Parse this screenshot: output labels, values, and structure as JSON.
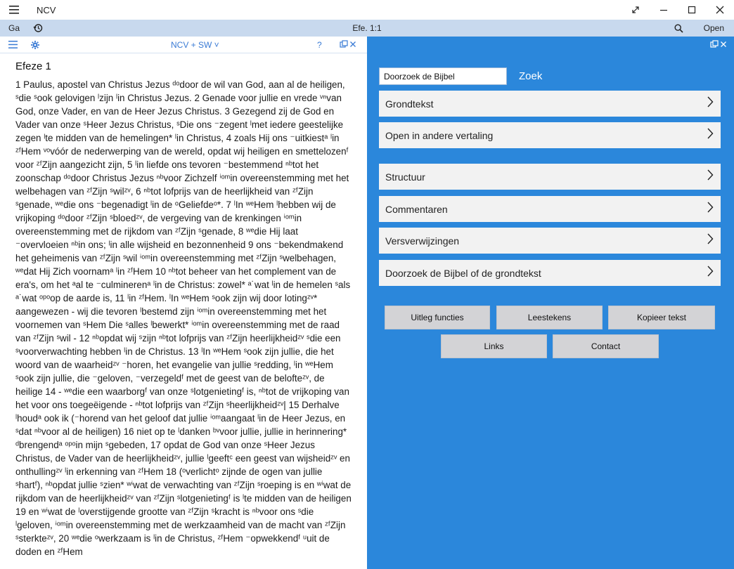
{
  "app": {
    "title": "NCV"
  },
  "window": {
    "minimize": "",
    "maximize": "",
    "close": ""
  },
  "command_bar": {
    "ga_label": "Ga",
    "reference": "Efe. 1:1",
    "open_label": "Open"
  },
  "left_pane": {
    "version_label": "NCV + SW ˅",
    "help_label": "?",
    "chapter_title": "Efeze 1",
    "text": "1 Paulus, apostel van Christus Jezus ᵈᵒdoor de wil van God, aan al de heiligen, ˢdie ˢook gelovigen ˡzijn ˡin Christus Jezus. 2 Genade voor jullie en vrede ᵛⁿvan God, onze Vader, en van de Heer Jezus Christus. 3 Gezegend zij de God en Vader van onze ˢHeer Jezus Christus, ˢDie ons ⁻zegent ˡmet iedere geestelijke zegen ˡte midden van de hemelingen* ˡin Christus, 4 zoals Hij ons ⁻uitkiestᵃ ˡin ᶻᶠHem ᵛᵒvóór de nederwerping van de wereld, opdat wij heiligen en smettelozenᶠ voor ᶻᶠZijn aangezicht zijn, 5 ˡin liefde ons tevoren ⁻bestemmend ⁿᵇtot het zoonschap ᵈᵒdoor Christus Jezus ⁿᵇvoor Zichzelf ⁱᵒᵐin overeenstemming met het welbehagen van ᶻᶠZijn ˢwilᶻᵛ, 6 ⁿᵇtot lofprijs van de heerlijkheid van ᶻᶠZijn ˢgenade, ʷᵉdie ons ⁻begenadigt ˡin de ᵒGeliefdeᵒ*. 7 ˡIn ʷᵉHem ˡhebben wij de vrijkoping ᵈᵒdoor ᶻᶠZijn ˢbloedᶻᵛ, de vergeving van de krenkingen ⁱᵒᵐin overeenstemming met de rijkdom van ᶻᶠZijn ˢgenade, 8 ʷᵉdie Hij laat ⁻overvloeien ⁿᵇin ons; ˡin alle wijsheid en bezonnenheid 9 ons ⁻bekendmakend het geheimenis van ᶻᶠZijn ˢwil ⁱᵒᵐin overeenstemming met ᶻᶠZijn ˢwelbehagen, ʷᵉdat Hij Zich voornamᵃ ˡin ᶻᶠHem 10 ⁿᵇtot beheer van het complement van de era's, om het ᵃal te ⁻culminerenᵃ ˡin de Christus: zowel* ᵃ˙wat ˡin de hemelen ˢals ᵃ˙wat ᵒᵖᵒop de aarde is, 11 ˡin ᶻᶠHem. ˡIn ʷᵉHem ˢook zijn wij door lotingᶻᵛ* aangewezen - wij die tevoren ˡbestemd zijn ⁱᵒᵐin overeenstemming met het voornemen van ˢHem Die ˢalles ˡbewerkt* ⁱᵒᵐin overeenstemming met de raad van ᶻᶠZijn ˢwil - 12 ⁿᵇopdat wij ˢzijn ⁿᵇtot lofprijs van ᶻᶠZijn heerlijkheidᶻᵛ ˢdie een ˢvoorverwachting hebben ˡin de Christus. 13 ˡIn ʷᵉHem ˢook zijn jullie, die het woord van de waarheidᶻᵛ ⁻horen, het evangelie van jullie ˢredding, ˡin ʷᵉHem ˢook zijn jullie, die ⁻geloven, ⁻verzegeldᶠ met de geest van de belofteᶻᵛ, de heilige 14 - ʷᵉdie een waarborgᶠ van onze ˢlotgenietingᶠ is, ⁿᵇtot de vrijkoping van het voor ons toegeëigende - ⁿᵇtot lofprijs van ᶻᶠZijn ˢheerlijkheidᶻᵛ| 15 Derhalve ˡhoudᵃ ook ik (⁻horend van het geloof dat jullie ⁱᵒᵐaangaat ˡin de Heer Jezus, en ˢdat ⁿᵇvoor al de heiligen) 16 niet op te ˡdanken ᵇᵛvoor jullie, jullie in herinnering* ᵈbrengendᵃ ᵒᵖᵒin mijn ˢgebeden, 17 opdat de God van onze ˢHeer Jezus Christus, de Vader van de heerlijkheidᶻᵛ, jullie ˡgeeftᶜ een geest van wijsheidᶻᵛ en onthullingᶻᵛ ˡin erkenning van ᶻᶠHem 18 (ᵒverlichtᵒ zijnde de ogen van jullie ˢhartᶠ), ⁿᵇopdat jullie ˢzien* ʷⁱwat de verwachting van ᶻᶠZijn ˢroeping is en ʷⁱwat de rijkdom van de heerlijkheidᶻᵛ van ᶻᶠZijn ˢlotgenietingᶠ is ˡte midden van de heiligen 19 en ʷⁱwat de ˡoverstijgende grootte van ᶻᶠZijn ˢkracht is ⁿᵇvoor ons ˢdie ˡgeloven, ⁱᵒᵐin overeenstemming met de werkzaamheid van de macht van ᶻᶠZijn ˢsterkteᶻᵛ, 20 ʷᵉdie ᵒwerkzaam is ˡin de Christus, ᶻᶠHem ⁻opwekkendᶠ ᵘuit de doden en ᶻᶠHem"
  },
  "right_pane": {
    "search_placeholder": "Doorzoek de Bijbel",
    "search_button": "Zoek",
    "nav_items": [
      {
        "label": "Grondtekst"
      },
      {
        "label": "Open in andere vertaling"
      },
      {
        "label": "Structuur"
      },
      {
        "label": "Commentaren"
      },
      {
        "label": "Versverwijzingen"
      },
      {
        "label": "Doorzoek de Bijbel of de grondtekst"
      }
    ],
    "buttons": {
      "uitleg": "Uitleg functies",
      "leestekens": "Leestekens",
      "kopieer": "Kopieer tekst",
      "links": "Links",
      "contact": "Contact"
    }
  },
  "colors": {
    "accent_blue": "#2b87db",
    "command_bar": "#c8d9ee",
    "nav_item_bg": "#f2f2f2",
    "button_bg": "#d3d3d6"
  }
}
